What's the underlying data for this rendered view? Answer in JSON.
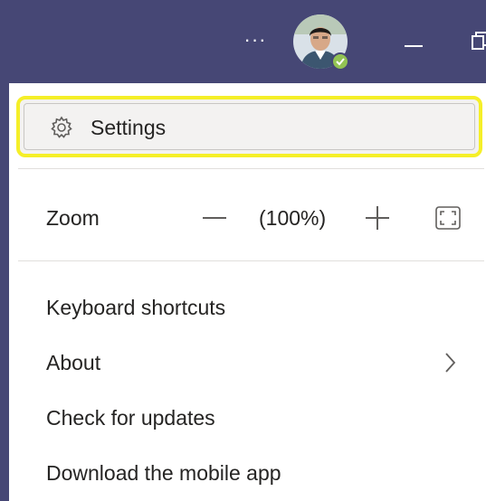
{
  "titlebar": {
    "more_label": "···",
    "presence_status_color": "#92c353",
    "bar_color": "#464775"
  },
  "menu": {
    "settings_label": "Settings",
    "zoom": {
      "label": "Zoom",
      "value": "(100%)"
    },
    "items": [
      {
        "label": "Keyboard shortcuts"
      },
      {
        "label": "About"
      },
      {
        "label": "Check for updates"
      },
      {
        "label": "Download the mobile app"
      }
    ],
    "highlight_color": "#f5ef28"
  }
}
